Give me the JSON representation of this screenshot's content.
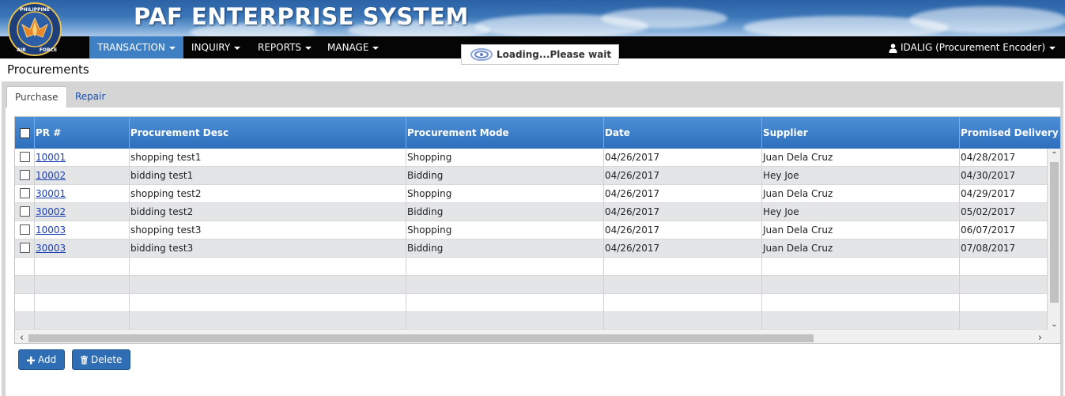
{
  "header": {
    "title": "PAF ENTERPRISE SYSTEM",
    "logo_text": [
      "PHILIPPINE",
      "AIR",
      "FORCE"
    ]
  },
  "nav": {
    "items": [
      {
        "label": "TRANSACTION",
        "active": true
      },
      {
        "label": "INQUIRY",
        "active": false
      },
      {
        "label": "REPORTS",
        "active": false
      },
      {
        "label": "MANAGE",
        "active": false
      }
    ],
    "user": "IDALIG (Procurement Encoder)"
  },
  "loading": {
    "text": "Loading...Please wait"
  },
  "page": {
    "title": "Procurements"
  },
  "tabs": [
    {
      "label": "Purchase",
      "selected": true
    },
    {
      "label": "Repair",
      "selected": false
    }
  ],
  "grid": {
    "columns": [
      "PR #",
      "Procurement Desc",
      "Procurement Mode",
      "Date",
      "Supplier",
      "Promised Delivery D"
    ],
    "rows": [
      {
        "pr": "10001",
        "desc": "shopping test1",
        "mode": "Shopping",
        "date": "04/26/2017",
        "supplier": "Juan Dela Cruz",
        "delivery": "04/28/2017"
      },
      {
        "pr": "10002",
        "desc": "bidding test1",
        "mode": "Bidding",
        "date": "04/26/2017",
        "supplier": "Hey Joe",
        "delivery": "04/30/2017"
      },
      {
        "pr": "30001",
        "desc": "shopping test2",
        "mode": "Shopping",
        "date": "04/26/2017",
        "supplier": "Juan Dela Cruz",
        "delivery": "04/29/2017"
      },
      {
        "pr": "30002",
        "desc": "bidding test2",
        "mode": "Bidding",
        "date": "04/26/2017",
        "supplier": "Hey Joe",
        "delivery": "05/02/2017"
      },
      {
        "pr": "10003",
        "desc": "shopping test3",
        "mode": "Shopping",
        "date": "04/26/2017",
        "supplier": "Juan Dela Cruz",
        "delivery": "06/07/2017"
      },
      {
        "pr": "30003",
        "desc": "bidding test3",
        "mode": "Bidding",
        "date": "04/26/2017",
        "supplier": "Juan Dela Cruz",
        "delivery": "07/08/2017"
      }
    ]
  },
  "buttons": {
    "add": "Add",
    "delete": "Delete"
  },
  "icons": {
    "user": "user-icon",
    "add": "plus-icon",
    "delete": "trash-icon",
    "loading": "spinner-icon"
  },
  "colors": {
    "nav_bg": "#050505",
    "active_tab": "#3f7fc4",
    "grid_header": "#2e6fbc",
    "button": "#2f6db5",
    "link": "#1a3fb0"
  }
}
